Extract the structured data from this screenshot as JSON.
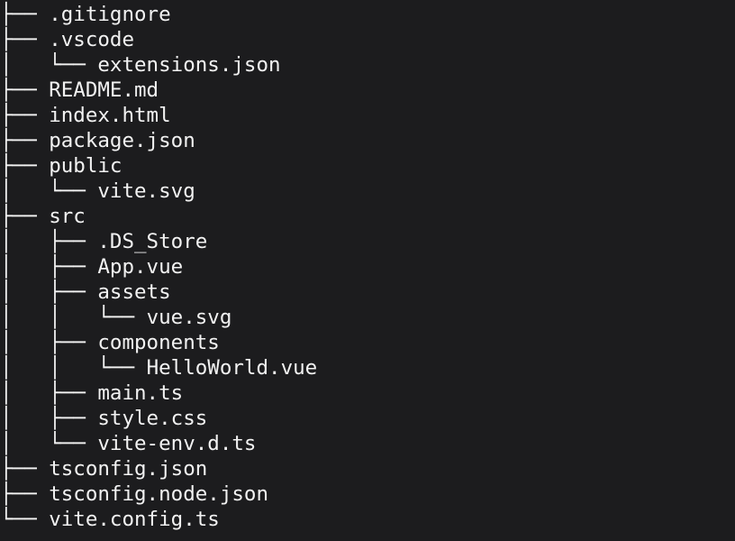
{
  "theme": {
    "background": "#1c1c1e",
    "foreground": "#f2f2f2"
  },
  "tree": {
    "lines": [
      {
        "prefix": "├── ",
        "name": ".gitignore"
      },
      {
        "prefix": "├── ",
        "name": ".vscode"
      },
      {
        "prefix": "│   └── ",
        "name": "extensions.json"
      },
      {
        "prefix": "├── ",
        "name": "README.md"
      },
      {
        "prefix": "├── ",
        "name": "index.html"
      },
      {
        "prefix": "├── ",
        "name": "package.json"
      },
      {
        "prefix": "├── ",
        "name": "public"
      },
      {
        "prefix": "│   └── ",
        "name": "vite.svg"
      },
      {
        "prefix": "├── ",
        "name": "src"
      },
      {
        "prefix": "│   ├── ",
        "name": ".DS_Store"
      },
      {
        "prefix": "│   ├── ",
        "name": "App.vue"
      },
      {
        "prefix": "│   ├── ",
        "name": "assets"
      },
      {
        "prefix": "│   │   └── ",
        "name": "vue.svg"
      },
      {
        "prefix": "│   ├── ",
        "name": "components"
      },
      {
        "prefix": "│   │   └── ",
        "name": "HelloWorld.vue"
      },
      {
        "prefix": "│   ├── ",
        "name": "main.ts"
      },
      {
        "prefix": "│   ├── ",
        "name": "style.css"
      },
      {
        "prefix": "│   └── ",
        "name": "vite-env.d.ts"
      },
      {
        "prefix": "├── ",
        "name": "tsconfig.json"
      },
      {
        "prefix": "├── ",
        "name": "tsconfig.node.json"
      },
      {
        "prefix": "└── ",
        "name": "vite.config.ts"
      }
    ]
  }
}
